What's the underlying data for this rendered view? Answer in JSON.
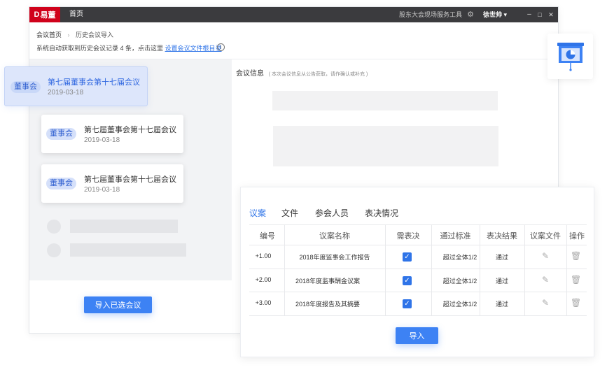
{
  "titlebar": {
    "brand": "易董",
    "home_tab": "首页",
    "tool_name": "股东大会现场服务工具",
    "user": "徐世帅 ▾",
    "minimize": "–",
    "maximize": "□",
    "close": "✕"
  },
  "breadcrumb": {
    "root": "会议首页",
    "separator": "›",
    "current": "历史会议导入"
  },
  "notice": {
    "text": "系统自动获取到历史会议记录 4 条，点击这里",
    "link": "设置会议文件根目录",
    "info": "i"
  },
  "meetings": [
    {
      "tag": "董事会",
      "name": "第七届董事会第十七届会议",
      "date": "2019-03-18"
    },
    {
      "tag": "董事会",
      "name": "第七届董事会第十七届会议",
      "date": "2019-03-18"
    },
    {
      "tag": "董事会",
      "name": "第七届董事会第十七届会议",
      "date": "2019-03-18"
    }
  ],
  "import_selected_label": "导入已选会议",
  "meeting_info": {
    "title": "会议信息",
    "hint": "( 本次会议信息从公告获取，请作确认或补充 )"
  },
  "tabs": [
    "议案",
    "文件",
    "参会人员",
    "表决情况"
  ],
  "table": {
    "columns": [
      "编号",
      "议案名称",
      "需表决",
      "通过标准",
      "表决结果",
      "议案文件",
      "操作"
    ],
    "rows": [
      {
        "no": "+1.00",
        "name": "2018年度监事会工作报告",
        "standard": "超过全体1/2",
        "result": "通过"
      },
      {
        "no": "+2.00",
        "name": "2018年度监事酬金议案",
        "standard": "超过全体1/2",
        "result": "通过"
      },
      {
        "no": "+3.00",
        "name": "2018年度报告及其摘要",
        "standard": "超过全体1/2",
        "result": "通过"
      }
    ]
  },
  "import_label": "导入",
  "colors": {
    "accent": "#3d82f4",
    "brand": "#d0021b",
    "titlebar": "#3b3b3e"
  }
}
